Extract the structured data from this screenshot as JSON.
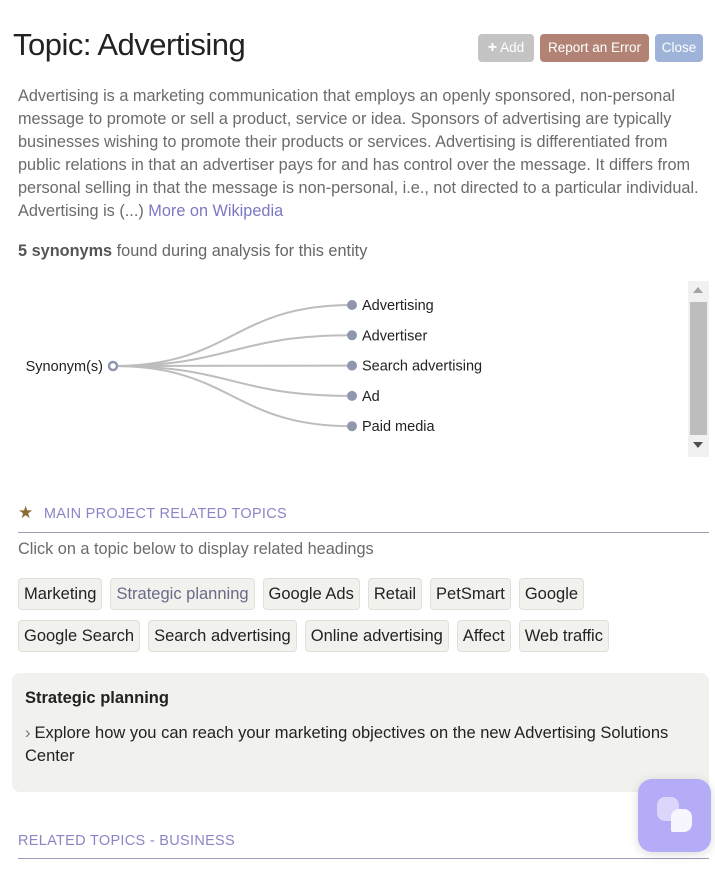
{
  "header": {
    "title": "Topic: Advertising",
    "buttons": {
      "add_icon": "+",
      "add": "Add",
      "report": "Report an Error",
      "close": "Close"
    }
  },
  "description": {
    "text": "Advertising is a marketing communication that employs an openly sponsored, non-personal message to promote or sell a product, service or idea. Sponsors of advertising are typically businesses wishing to promote their products or services. Advertising is differentiated from public relations in that an advertiser pays for and has control over the message. It differs from personal selling in that the message is non-personal, i.e., not directed to a particular individual. Advertising is (...)",
    "link": "More on Wikipedia"
  },
  "synonyms": {
    "count_label": "5 synonyms",
    "suffix": "found during analysis for this entity",
    "root": "Synonym(s)",
    "items": [
      "Advertising",
      "Advertiser",
      "Search advertising",
      "Ad",
      "Paid media"
    ]
  },
  "main_topics": {
    "heading": "MAIN PROJECT RELATED TOPICS",
    "star_icon": "★",
    "hint": "Click on a topic below to display related headings",
    "chips": [
      {
        "label": "Marketing",
        "active": false
      },
      {
        "label": "Strategic planning",
        "active": true
      },
      {
        "label": "Google Ads",
        "active": false
      },
      {
        "label": "Retail",
        "active": false
      },
      {
        "label": "PetSmart",
        "active": false
      },
      {
        "label": "Google",
        "active": false
      },
      {
        "label": "Google Search",
        "active": false
      },
      {
        "label": "Search advertising",
        "active": false
      },
      {
        "label": "Online advertising",
        "active": false
      },
      {
        "label": "Affect",
        "active": false
      },
      {
        "label": "Web traffic",
        "active": false
      }
    ]
  },
  "detail_panel": {
    "title": "Strategic planning",
    "chevron": "›",
    "text": "Explore how you can reach your marketing objectives on the new Advertising Solutions Center"
  },
  "related_business": {
    "heading": "RELATED TOPICS - BUSINESS"
  },
  "colors": {
    "accent": "#8a86c6",
    "link": "#7a78c4",
    "add_button": "#c4c4c4",
    "report_button": "#b28375",
    "close_button": "#9fb3d8",
    "node": "#8e97ad",
    "fab": "#b4acf6"
  }
}
